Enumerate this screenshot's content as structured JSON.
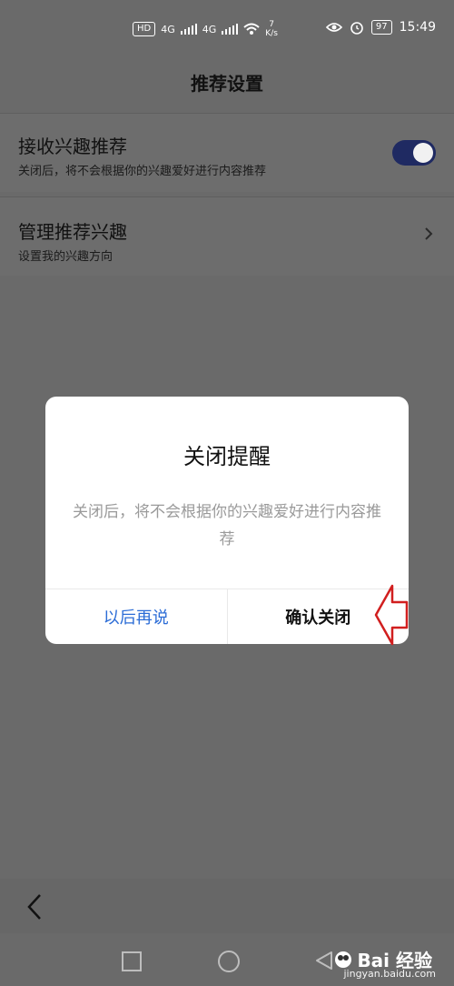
{
  "status_bar": {
    "hd": "HD",
    "sim1_net": "4G",
    "sim2_net": "4G",
    "speed_value": "7",
    "speed_unit": "K/s",
    "battery": "97",
    "time": "15:49",
    "icons": [
      "hd-icon",
      "signal-icon",
      "wifi-icon",
      "eye-icon",
      "alarm-icon",
      "battery-icon"
    ]
  },
  "header": {
    "title": "推荐设置"
  },
  "settings": {
    "items": [
      {
        "title": "接收兴趣推荐",
        "subtitle": "关闭后，将不会根据你的兴趣爱好进行内容推荐",
        "toggle_on": true
      },
      {
        "title": "管理推荐兴趣",
        "subtitle": "设置我的兴趣方向"
      }
    ]
  },
  "dialog": {
    "title": "关闭提醒",
    "message": "关闭后，将不会根据你的兴趣爱好进行内容推荐",
    "cancel_label": "以后再说",
    "confirm_label": "确认关闭"
  },
  "watermark": {
    "brand": "Bai 经验",
    "site": "jingyan.baidu.com"
  },
  "colors": {
    "toggle_on": "#1f2a62",
    "cancel_text": "#2b6cd6",
    "annotation_arrow": "#d11f1f"
  }
}
